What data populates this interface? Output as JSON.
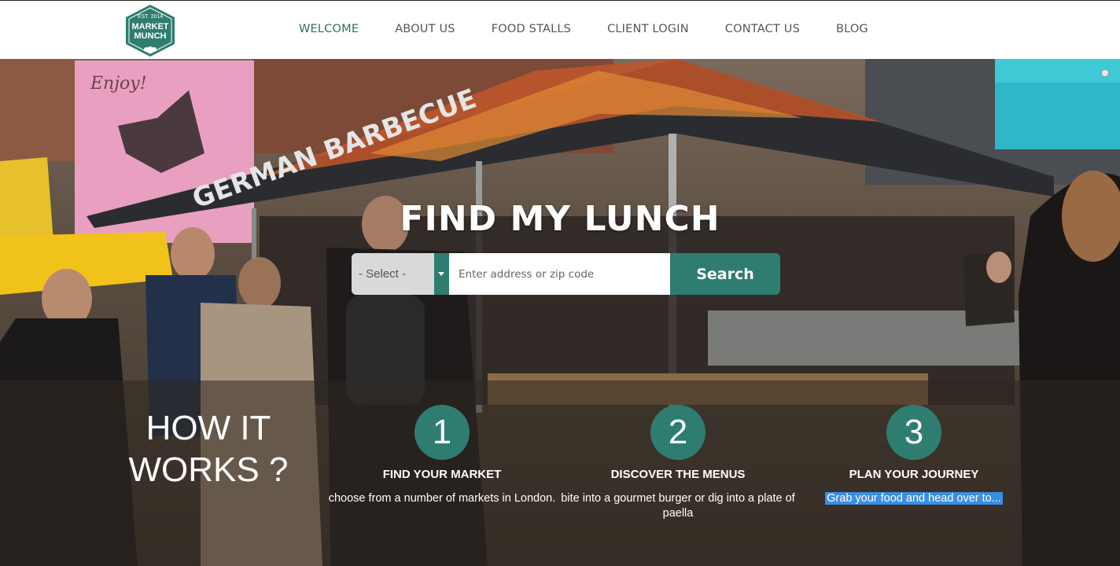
{
  "brand": {
    "logo_line1": "EST. 2014",
    "logo_line2": "MARKET",
    "logo_line3": "MUNCH",
    "color": "#2e7d70"
  },
  "nav": {
    "items": [
      {
        "label": "WELCOME",
        "active": true
      },
      {
        "label": "ABOUT US",
        "active": false
      },
      {
        "label": "FOOD STALLS",
        "active": false
      },
      {
        "label": "CLIENT LOGIN",
        "active": false
      },
      {
        "label": "CONTACT US",
        "active": false
      },
      {
        "label": "BLOG",
        "active": false
      }
    ]
  },
  "hero": {
    "title": "FIND MY LUNCH",
    "canopy_text": "GERMAN BARBECUE",
    "banner_text": "Enjoy!"
  },
  "search": {
    "select_value": "- Select -",
    "address_placeholder": "Enter address or zip code",
    "button_label": "Search"
  },
  "how": {
    "title": "HOW IT WORKS ?",
    "steps": [
      {
        "number": "1",
        "label": "FIND YOUR MARKET",
        "desc": "choose from a number of markets in London."
      },
      {
        "number": "2",
        "label": "DISCOVER THE MENUS",
        "desc": "bite into a gourmet burger or dig into a plate of paella"
      },
      {
        "number": "3",
        "label": "PLAN YOUR JOURNEY",
        "desc": "Grab your food and head over to..."
      }
    ]
  }
}
